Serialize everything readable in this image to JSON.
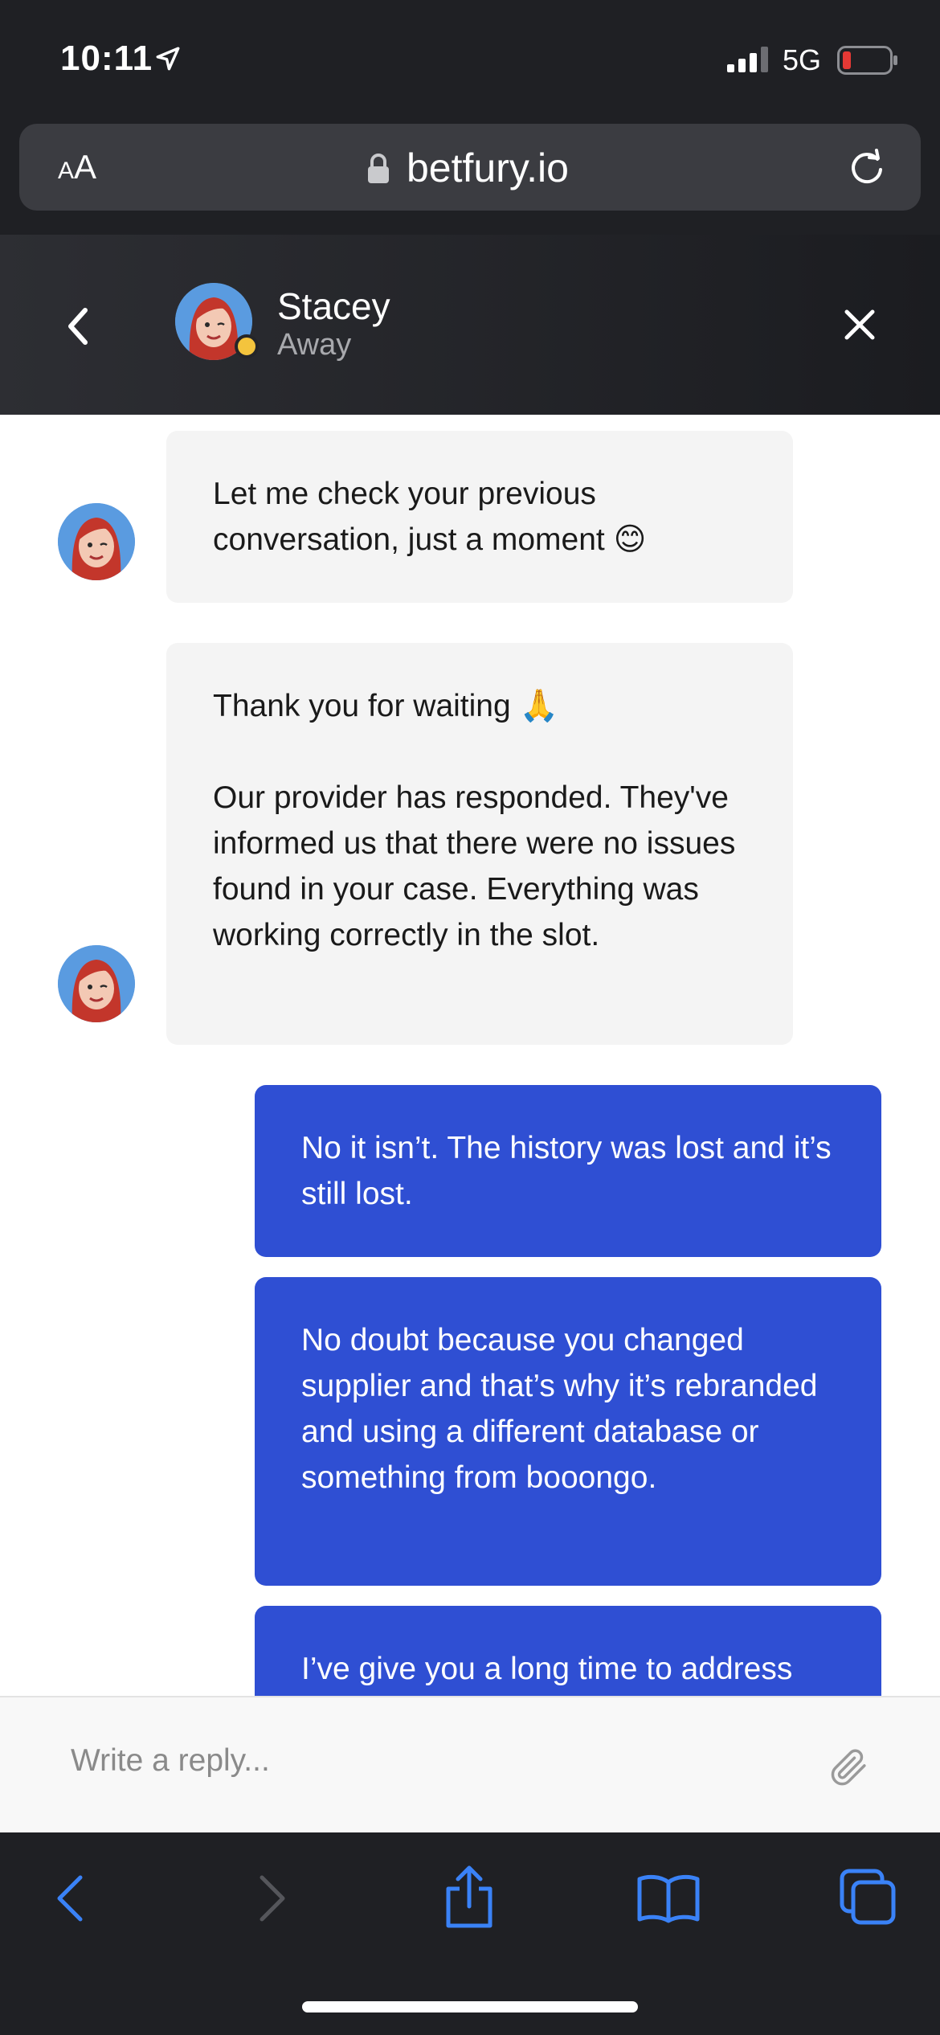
{
  "status_bar": {
    "time": "10:11",
    "network": "5G"
  },
  "browser": {
    "text_size_label_small": "A",
    "text_size_label_large": "A",
    "url": "betfury.io"
  },
  "chat_header": {
    "agent_name": "Stacey",
    "agent_status": "Away"
  },
  "messages": [
    {
      "sender": "agent",
      "paragraphs": [
        "Let me check your previous conversation, just a moment 😊"
      ]
    },
    {
      "sender": "agent",
      "paragraphs": [
        "Thank you for waiting 🙏",
        "Our provider has responded. They've informed us that there were no issues found in your case. Everything was working correctly in the slot."
      ]
    },
    {
      "sender": "user",
      "paragraphs": [
        "No it isn’t. The history was lost and it’s still lost."
      ]
    },
    {
      "sender": "user",
      "paragraphs": [
        "No doubt because you changed supplier and that’s why it’s rebranded and using a different database or something from booongo."
      ]
    },
    {
      "sender": "user",
      "paragraphs": [
        "I’ve give you a long time to address"
      ]
    }
  ],
  "reply": {
    "placeholder": "Write a reply..."
  },
  "colors": {
    "user_bubble": "#2f4fd3",
    "agent_bubble": "#f4f4f4",
    "toolbar_icon": "#3a82f7",
    "away_dot": "#f4c43d",
    "battery_low": "#e53935"
  }
}
